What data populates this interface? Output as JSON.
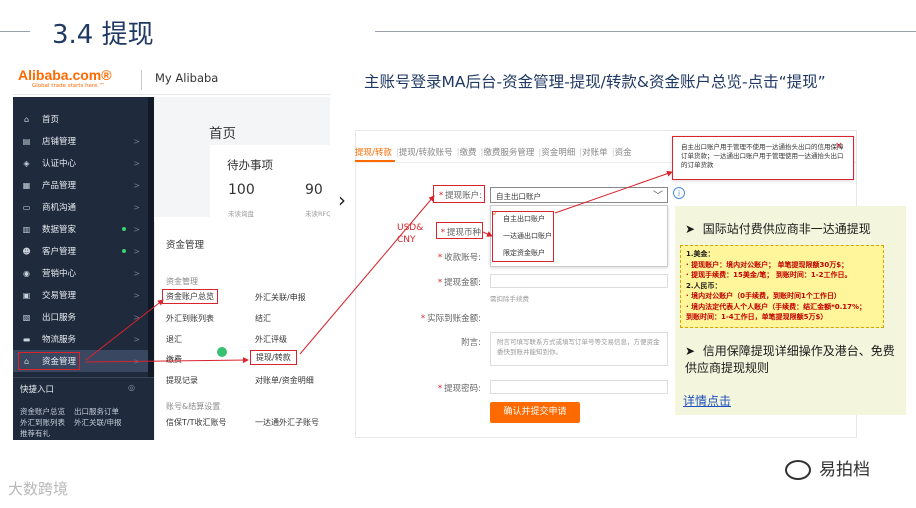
{
  "slide": {
    "title": "3.4 提现",
    "subtitle": "主账号登录MA后台-资金管理-提现/转款&资金账户总览-点击“提现”"
  },
  "alibaba": {
    "logo": "Alibaba.com®",
    "logo_tagline": "Global trade starts here.™",
    "my_alibaba": "My Alibaba",
    "sidebar": [
      {
        "label": "首页",
        "icon": "home-icon",
        "glyph": "⌂"
      },
      {
        "label": "店铺管理",
        "icon": "shop-icon",
        "glyph": "▤"
      },
      {
        "label": "认证中心",
        "icon": "shield-icon",
        "glyph": "◈"
      },
      {
        "label": "产品管理",
        "icon": "grid-icon",
        "glyph": "▦"
      },
      {
        "label": "商机沟通",
        "icon": "chat-icon",
        "glyph": "▭"
      },
      {
        "label": "数据管家",
        "icon": "chart-icon",
        "glyph": "▥"
      },
      {
        "label": "客户管理",
        "icon": "user-icon",
        "glyph": "☻"
      },
      {
        "label": "营销中心",
        "icon": "marketing-icon",
        "glyph": "◉"
      },
      {
        "label": "交易管理",
        "icon": "trade-icon",
        "glyph": "▣"
      },
      {
        "label": "出口服务",
        "icon": "export-icon",
        "glyph": "▧"
      },
      {
        "label": "物流服务",
        "icon": "truck-icon",
        "glyph": "▬"
      },
      {
        "label": "资金管理",
        "icon": "bank-icon",
        "glyph": "⌂"
      }
    ],
    "arrow": ">",
    "quick_entry": {
      "title": "快捷入口",
      "gear": "◎",
      "links": [
        "资金账户总览",
        "出口服务订单",
        "外汇到账列表",
        "外汇关联/申报",
        "推荐有礼"
      ]
    },
    "home_title": "首页",
    "todo": {
      "title": "待办事项",
      "count1": "100",
      "count2": "90",
      "label1": "未读询盘",
      "label2": "未读RFQ"
    },
    "fund_menu": {
      "title": "资金管理",
      "section1": "资金管理",
      "items": [
        "资金账户总览",
        "外汇关联/申报",
        "外汇到账列表",
        "结汇",
        "退汇",
        "外汇评级",
        "缴费",
        "提现/转款",
        "提现记录",
        "对账单/资金明细"
      ],
      "section2": "账号&结算设置",
      "items2": [
        "信保T/T收汇账号",
        "一达通外汇子账号"
      ]
    }
  },
  "form": {
    "tabs": [
      "提现/转款",
      "提现/转款账号",
      "缴费",
      "缴费服务管理",
      "资金明细",
      "对账单",
      "资金"
    ],
    "tab_sep": "|",
    "account_label": "提现账户:",
    "account_value": "自主出口账户",
    "dropdown_arrow": "﹀",
    "info_glyph": "i",
    "options": [
      "自主出口账户",
      "一达通出口账户",
      "限定资金账户"
    ],
    "check_glyph": "✓",
    "currency_label": "提现币种",
    "currency_annot": "USD& CNY",
    "receive_label": "收款账号:",
    "amount_label": "提现金额:",
    "amount_hint": "需扣除手续费",
    "actual_label": "实际到账金额:",
    "note_label": "附言:",
    "note_placeholder": "附言可填写联系方式或填写订单号等交易信息，方便资金委快到账并能知到你。",
    "password_label": "提现密码:",
    "submit": "确认并提交申请",
    "tooltip": "自主出口账户用于管理不使用一达通抬头出口的信用保障订单货款；一达通出口账户用于管理使用一达通抬头出口的订单货款",
    "tooltip_close": "×"
  },
  "notes": {
    "bullet": "➤",
    "heading": "国际站付费供应商非一达通提现",
    "lines": [
      {
        "text": "1.美金：",
        "emph": false
      },
      {
        "text": "· 提现账户：境内对公账户； 单笔提现限额30万$；",
        "emph": true
      },
      {
        "text": "· 提现手续费：15美金/笔； 到账时间：1-2工作日。",
        "emph": true
      },
      {
        "text": "2.人民币：",
        "emph": false
      },
      {
        "text": "· 境内对公账户（0手续费，到账时间1个工作日）",
        "emph": true
      },
      {
        "text": "· 境内法定代表人个人账户（手续费：结汇金额*0.17%；",
        "emph": true
      },
      {
        "text": "  到账时间：1-4工作日，单笔提现限额5万$）",
        "emph": true
      }
    ],
    "note": "信用保障提现详细操作及港台、免费供应商提现规则",
    "link": "详情点击"
  },
  "watermarks": {
    "left": "大数跨境",
    "right": "易拍档"
  },
  "colors": {
    "accent": "#ff6a00",
    "title": "#1f3864",
    "annotation": "#d9232d",
    "sidebar": "#1f2a3c"
  }
}
